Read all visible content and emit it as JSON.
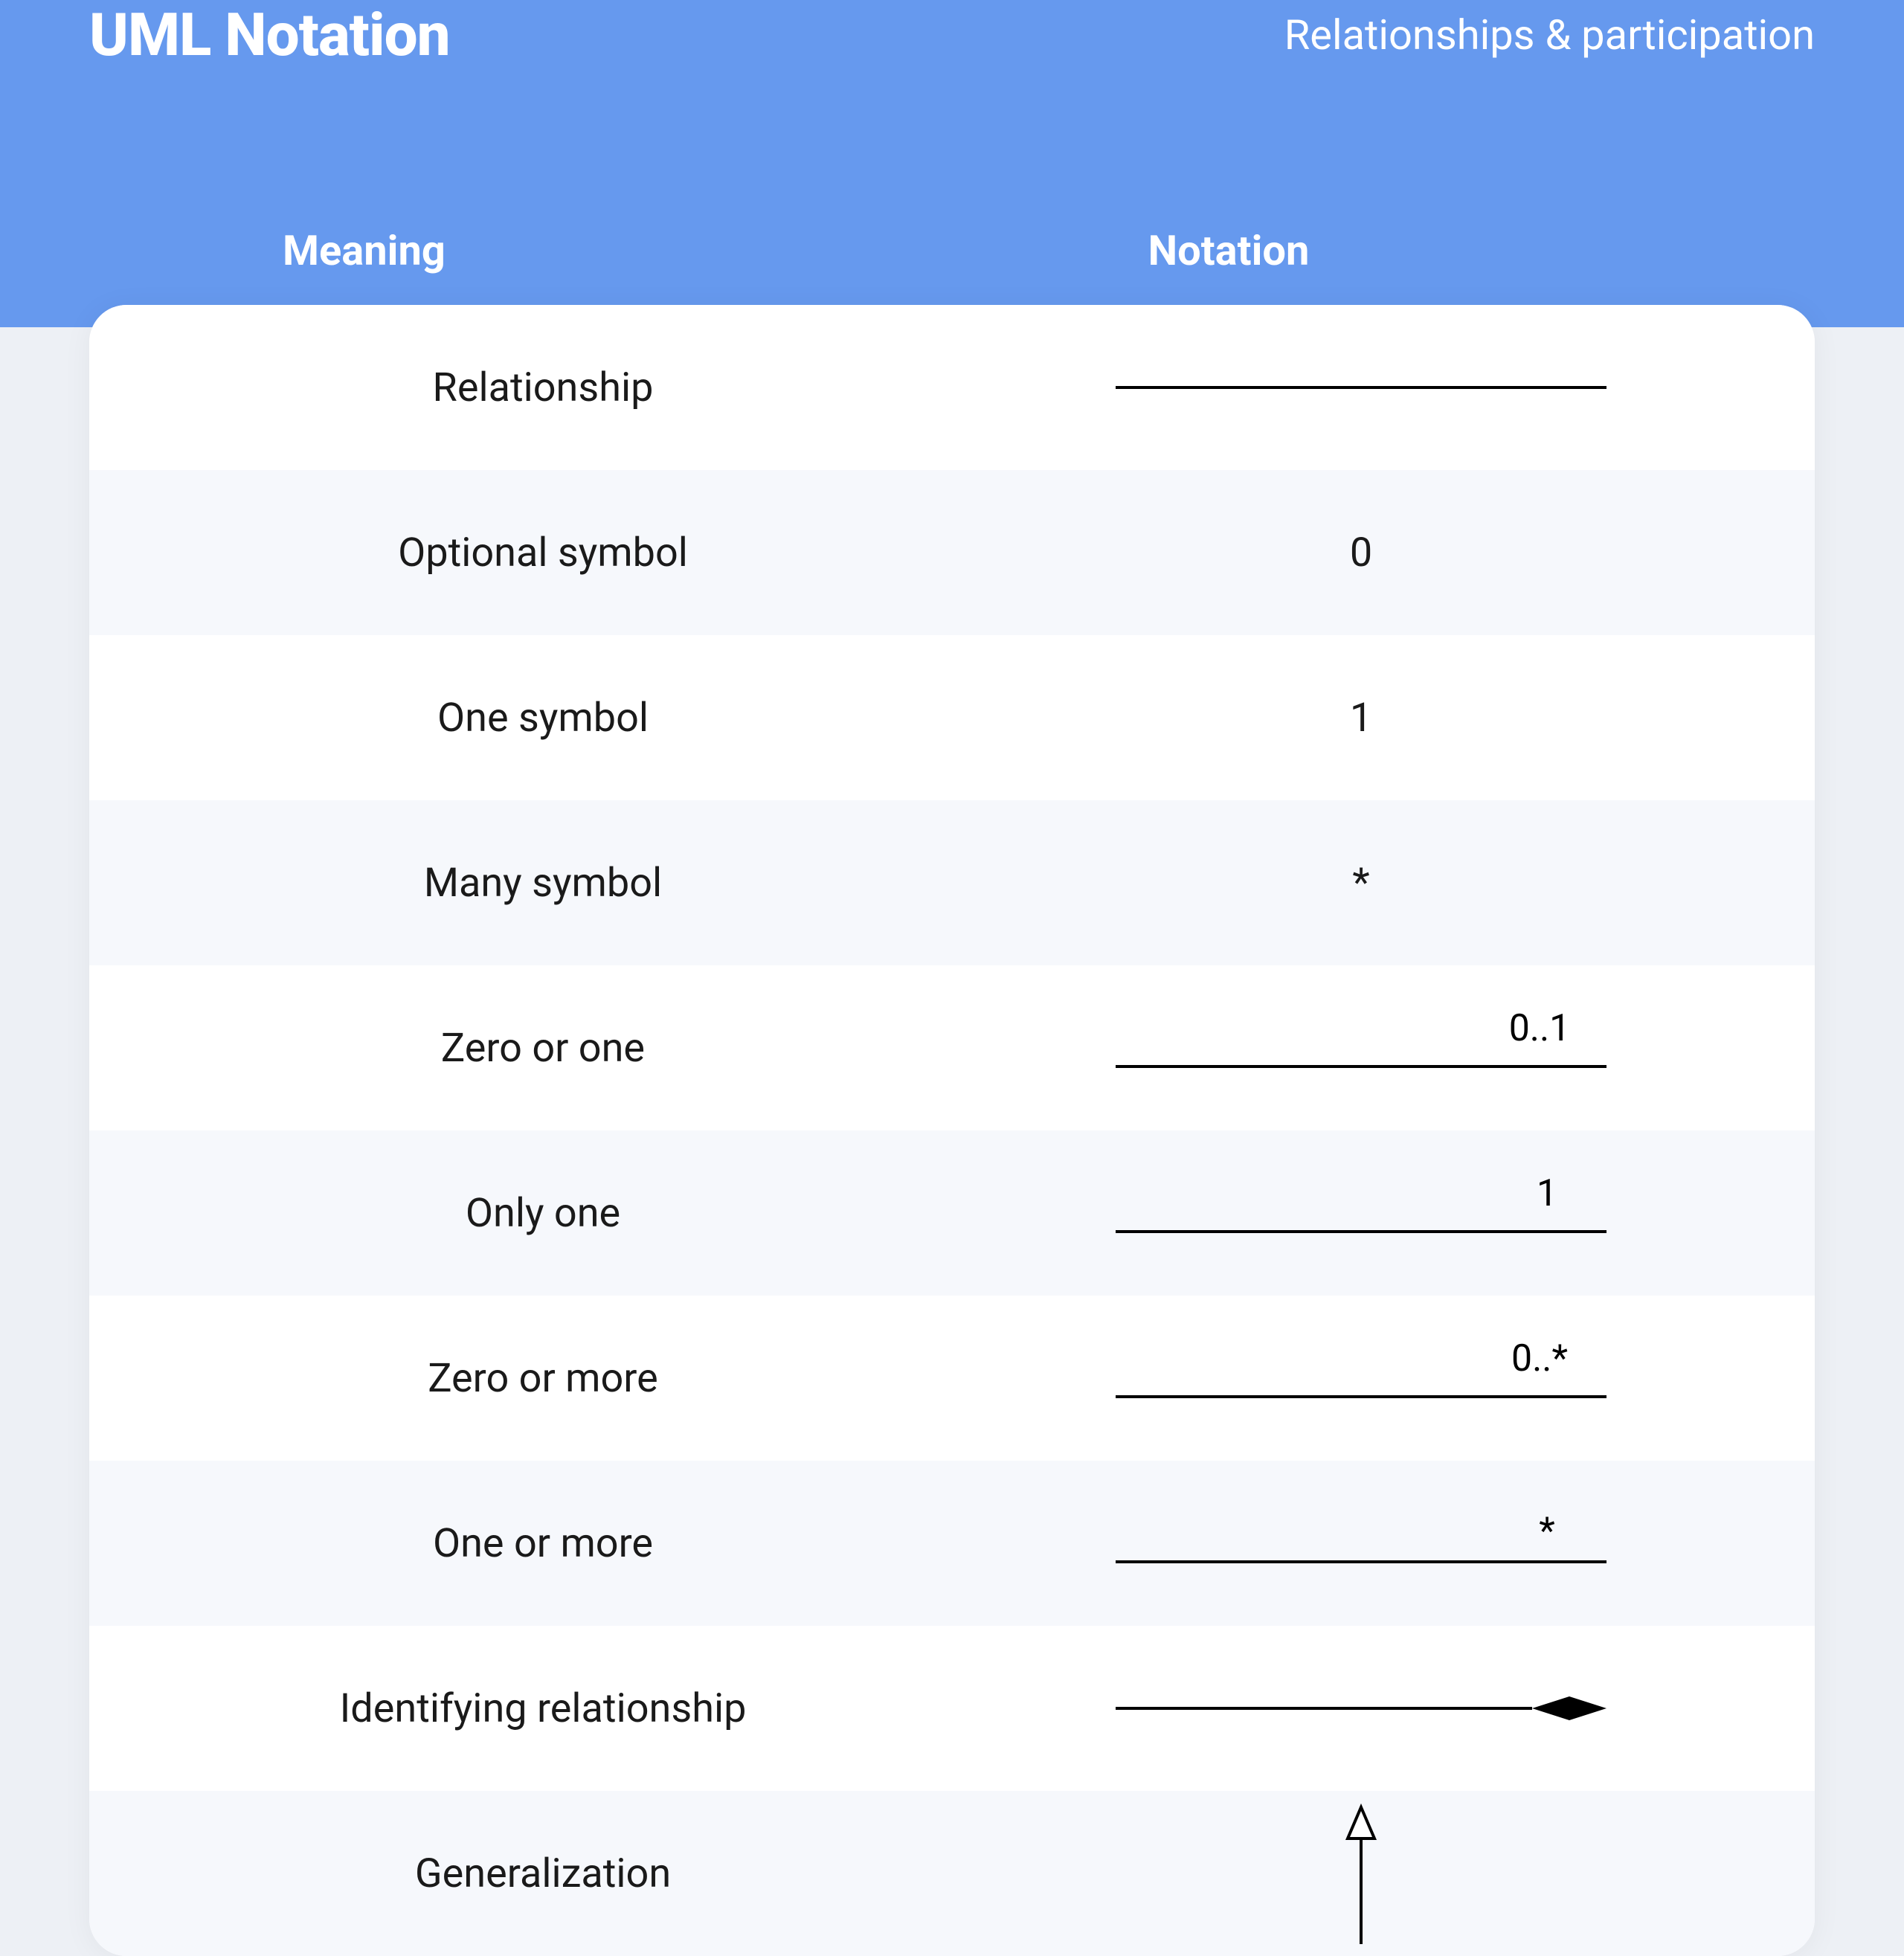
{
  "header": {
    "title": "UML Notation",
    "subtitle": "Relationships & participation",
    "col_meaning": "Meaning",
    "col_notation": "Notation"
  },
  "rows": [
    {
      "meaning": "Relationship",
      "type": "line",
      "label": ""
    },
    {
      "meaning": "Optional symbol",
      "type": "text",
      "label": "0"
    },
    {
      "meaning": "One symbol",
      "type": "text",
      "label": "1"
    },
    {
      "meaning": "Many symbol",
      "type": "text",
      "label": "*"
    },
    {
      "meaning": "Zero or one",
      "type": "line_label",
      "label": "0..1"
    },
    {
      "meaning": "Only one",
      "type": "line_label",
      "label": "1"
    },
    {
      "meaning": "Zero or more",
      "type": "line_label",
      "label": "0..*"
    },
    {
      "meaning": "One or more",
      "type": "line_label",
      "label": "*"
    },
    {
      "meaning": "Identifying relationship",
      "type": "line_diamond",
      "label": ""
    },
    {
      "meaning": "Generalization",
      "type": "arrow_up",
      "label": ""
    }
  ]
}
